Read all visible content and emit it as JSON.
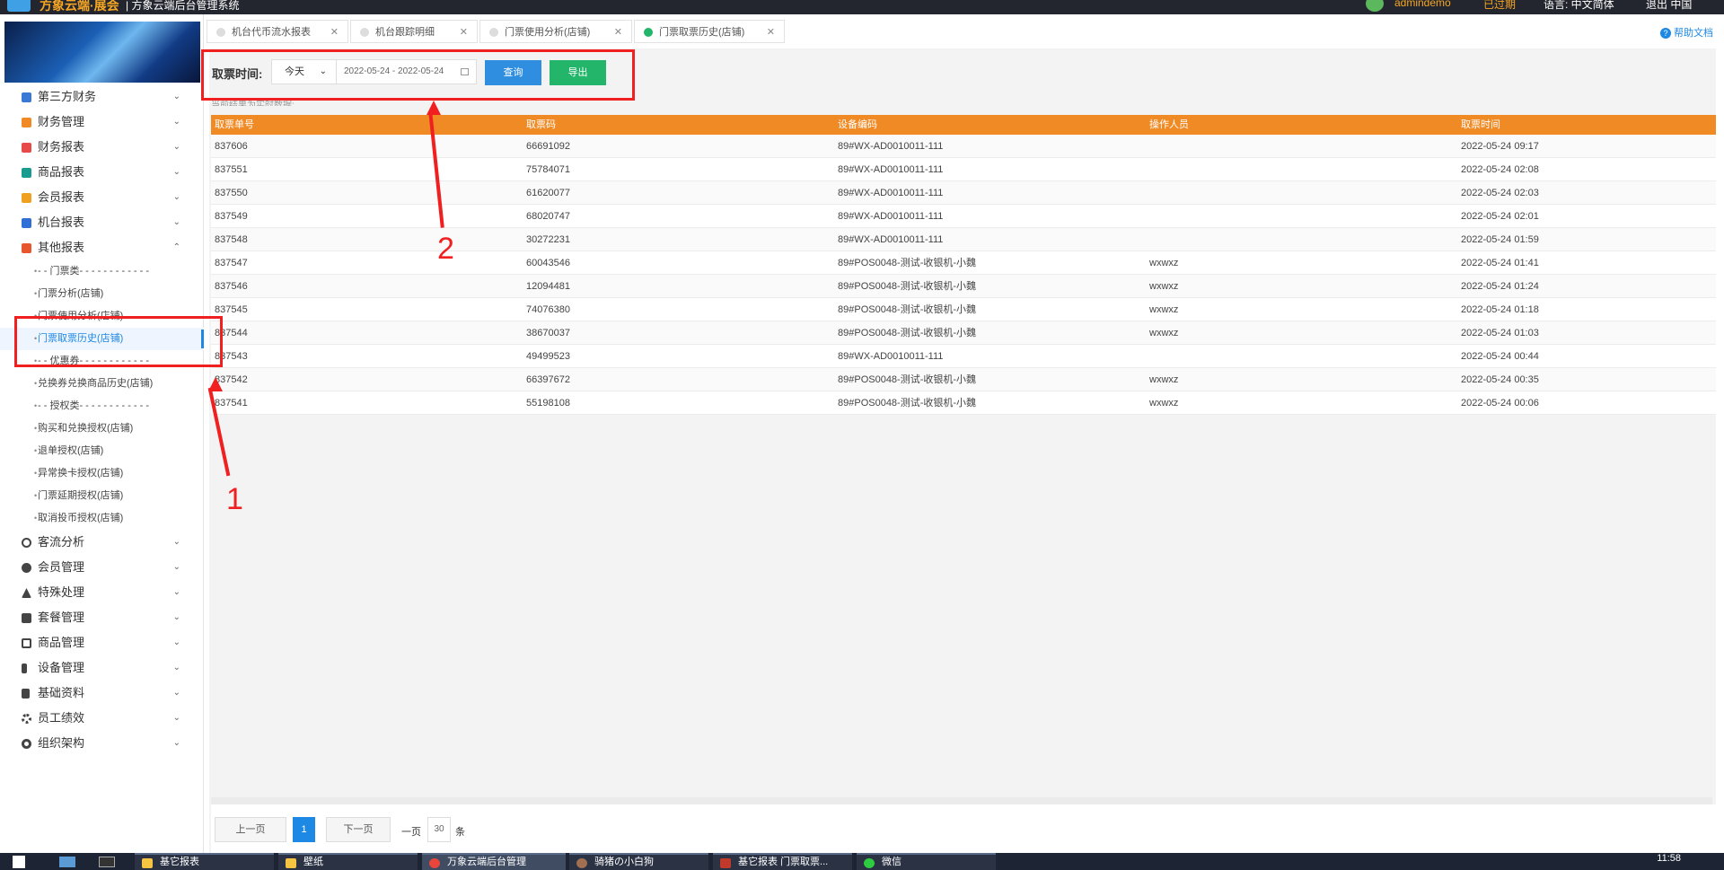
{
  "topbar": {
    "brand": "方象云端·展会",
    "subtitle": "| 方象云端后台管理系统",
    "user": "admindemo",
    "link1": "已过期",
    "lang": "语言: 中文简体",
    "exit": "退出  中国"
  },
  "sidebar": {
    "menu": [
      {
        "label": "第三方财务",
        "icon": "finance-icon",
        "color": "#3a78d6"
      },
      {
        "label": "财务管理",
        "icon": "ledger-icon",
        "color": "#f08a24"
      },
      {
        "label": "财务报表",
        "icon": "report-icon",
        "color": "#e84a4a"
      },
      {
        "label": "商品报表",
        "icon": "product-report-icon",
        "color": "#1a9b8f"
      },
      {
        "label": "会员报表",
        "icon": "member-report-icon",
        "color": "#f0a020"
      },
      {
        "label": "机台报表",
        "icon": "machine-report-icon",
        "color": "#2f6fd6"
      },
      {
        "label": "其他报表",
        "icon": "layers-icon",
        "color": "#e8562e"
      }
    ],
    "submenu": [
      "- - 门票类- - - - - - - - - - - -",
      "门票分析(店铺)",
      "门票使用分析(店铺)",
      "门票取票历史(店铺)",
      "- - 优惠券- - - - - - - - - - - -",
      "兑换券兑换商品历史(店铺)",
      "- - 授权类- - - - - - - - - - - -",
      "购买和兑换授权(店铺)",
      "退单授权(店铺)",
      "异常换卡授权(店铺)",
      "门票延期授权(店铺)",
      "取消投币授权(店铺)"
    ],
    "menu2": [
      {
        "label": "客流分析",
        "icon": "traffic-icon"
      },
      {
        "label": "会员管理",
        "icon": "member-icon"
      },
      {
        "label": "特殊处理",
        "icon": "warning-icon"
      },
      {
        "label": "套餐管理",
        "icon": "package-icon"
      },
      {
        "label": "商品管理",
        "icon": "goods-icon"
      },
      {
        "label": "设备管理",
        "icon": "device-icon"
      },
      {
        "label": "基础资料",
        "icon": "document-icon"
      },
      {
        "label": "员工绩效",
        "icon": "gear-icon"
      },
      {
        "label": "组织架构",
        "icon": "org-icon"
      }
    ]
  },
  "tabs": [
    "机台代币流水报表",
    "机台跟踪明细",
    "门票使用分析(店铺)",
    "门票取票历史(店铺)"
  ],
  "help": "帮助文档",
  "filter": {
    "label": "取票时间:",
    "range": "今天",
    "date": "2022-05-24 - 2022-05-24",
    "query": "查询",
    "export": "导出"
  },
  "note": "当前结果为实时数据;",
  "table": {
    "headers": [
      "取票单号",
      "取票码",
      "设备编码",
      "操作人员",
      "取票时间"
    ],
    "rows": [
      [
        "837606",
        "66691092",
        "89#WX-AD0010011-111",
        "",
        "2022-05-24 09:17"
      ],
      [
        "837551",
        "75784071",
        "89#WX-AD0010011-111",
        "",
        "2022-05-24 02:08"
      ],
      [
        "837550",
        "61620077",
        "89#WX-AD0010011-111",
        "",
        "2022-05-24 02:03"
      ],
      [
        "837549",
        "68020747",
        "89#WX-AD0010011-111",
        "",
        "2022-05-24 02:01"
      ],
      [
        "837548",
        "30272231",
        "89#WX-AD0010011-111",
        "",
        "2022-05-24 01:59"
      ],
      [
        "837547",
        "60043546",
        "89#POS0048-测试-收银机-小魏",
        "wxwxz",
        "2022-05-24 01:41"
      ],
      [
        "837546",
        "12094481",
        "89#POS0048-测试-收银机-小魏",
        "wxwxz",
        "2022-05-24 01:24"
      ],
      [
        "837545",
        "74076380",
        "89#POS0048-测试-收银机-小魏",
        "wxwxz",
        "2022-05-24 01:18"
      ],
      [
        "837544",
        "38670037",
        "89#POS0048-测试-收银机-小魏",
        "wxwxz",
        "2022-05-24 01:03"
      ],
      [
        "837543",
        "49499523",
        "89#WX-AD0010011-111",
        "",
        "2022-05-24 00:44"
      ],
      [
        "837542",
        "66397672",
        "89#POS0048-测试-收银机-小魏",
        "wxwxz",
        "2022-05-24 00:35"
      ],
      [
        "837541",
        "55198108",
        "89#POS0048-测试-收银机-小魏",
        "wxwxz",
        "2022-05-24 00:06"
      ]
    ]
  },
  "pager": {
    "prev": "上一页",
    "current": "1",
    "next": "下一页",
    "per": "一页",
    "size": "30",
    "unit": "条"
  },
  "annotations": {
    "n1": "1",
    "n2": "2"
  },
  "taskbar": {
    "items": [
      "基它报表",
      "壁纸",
      "万象云端后台管理",
      "骑猪の小白狗",
      "基它报表 门票取票...",
      "微信"
    ],
    "time": "11:58"
  }
}
